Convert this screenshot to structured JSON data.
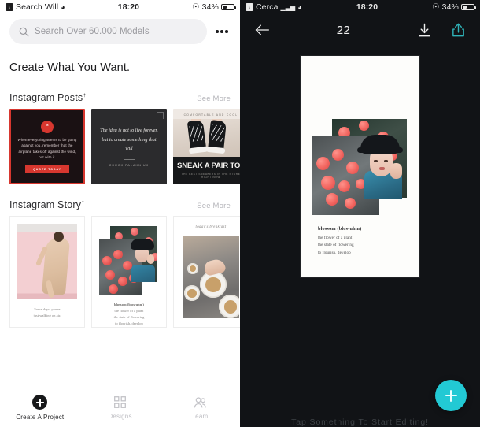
{
  "left": {
    "status": {
      "carrier": "Search Will",
      "back_glyph": "‹",
      "time": "18:20",
      "battery": "34%",
      "wifi_icon": "wifi-icon"
    },
    "search": {
      "placeholder": "Search Over 60.000 Models",
      "icon": "search-icon",
      "overflow_icon": "more-options-icon"
    },
    "headline": "Create What You Want.",
    "sections": [
      {
        "title": "Instagram Posts",
        "superscript": "↑",
        "see_more": "See More",
        "cards": [
          {
            "name": "quote-red-card",
            "badge": "“",
            "text": "When everything seems to be going against you, remember that the airplane takes off against the wind, not with it.",
            "button": "QUOTE TODAY"
          },
          {
            "name": "quote-dark-card",
            "quote": "The idea is not to live forever, but to create something that will",
            "author": "CHUCK PALAHNIUK"
          },
          {
            "name": "sneaker-card",
            "kicker": "COMFORTABLE AND COOL",
            "title": "SNEAK A PAIR TODAY",
            "subtitle": "THE BEST SNEAKERS IN THE STORE RIGHT NOW"
          }
        ]
      },
      {
        "title": "Instagram Story",
        "superscript": "↑",
        "see_more": "See More",
        "cards": [
          {
            "name": "fashion-story-card",
            "caption": [
              "Some days, you're",
              "just walking on air."
            ]
          },
          {
            "name": "blossom-story-card",
            "caption_title": "blossom (blos-uhm)",
            "caption": [
              "the flower of a plant",
              "the state of flowering",
              "to flourish, develop"
            ]
          },
          {
            "name": "breakfast-story-card",
            "kicker": "today's breakfast"
          }
        ]
      }
    ],
    "tabs": [
      {
        "label": "Create A Project",
        "icon": "plus-circle-icon",
        "active": true
      },
      {
        "label": "Designs",
        "icon": "grid-designs-icon",
        "active": false
      },
      {
        "label": "Team",
        "icon": "people-team-icon",
        "active": false
      }
    ]
  },
  "right": {
    "status": {
      "carrier": "Cerca",
      "back_glyph": "‹",
      "time": "18:20",
      "battery": "34%",
      "signal_icon": "signal-bars-icon",
      "wifi_icon": "wifi-icon"
    },
    "toolbar": {
      "back_icon": "back-arrow-icon",
      "count": "22",
      "download_icon": "download-icon",
      "share_icon": "share-icon"
    },
    "canvas": {
      "caption_title": "blossom (blos-uhm)",
      "caption_lines": [
        "the flower of a plant",
        "the state of flowering",
        "to flourish, develop"
      ]
    },
    "hint": "Tap Something To Start Editing!",
    "fab": {
      "label": "+",
      "icon": "add-icon"
    }
  },
  "colors": {
    "accent_teal": "#22c9d4",
    "accent_red": "#d7372f",
    "dark_bg": "#111316",
    "light_bg": "#ffffff"
  }
}
